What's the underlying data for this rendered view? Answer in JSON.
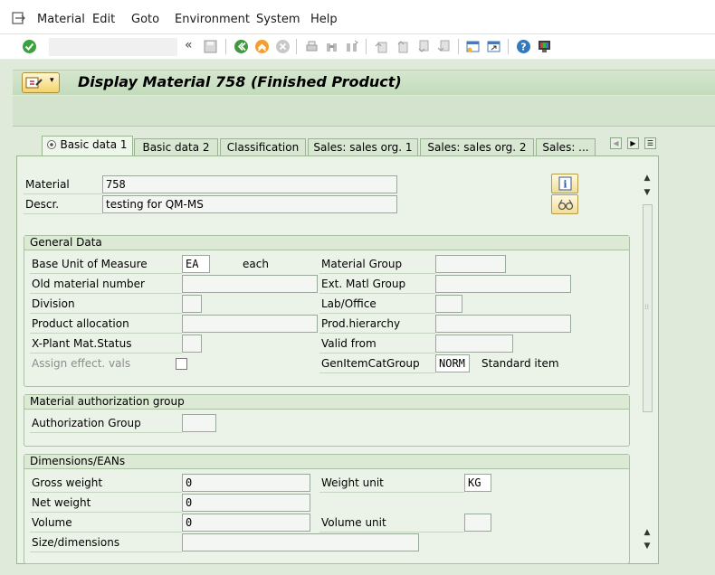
{
  "menu": {
    "items": [
      "Material",
      "Edit",
      "Goto",
      "Environment",
      "System",
      "Help"
    ]
  },
  "toolbar": {
    "command_value": "",
    "icons": [
      "enter-icon",
      "save-icon",
      "back-icon",
      "exit-icon",
      "cancel-icon",
      "print-icon",
      "find-icon",
      "find-next-icon",
      "first-page-icon",
      "previous-page-icon",
      "next-page-icon",
      "last-page-icon",
      "new-session-icon",
      "shortcut-icon",
      "help-icon",
      "customize-layout-icon"
    ]
  },
  "title": "Display Material 758 (Finished Product)",
  "tabs": [
    "Basic data 1",
    "Basic data 2",
    "Classification",
    "Sales: sales org. 1",
    "Sales: sales org. 2",
    "Sales: ..."
  ],
  "header": {
    "material_label": "Material",
    "material_value": "758",
    "descr_label": "Descr.",
    "descr_value": "testing for QM-MS"
  },
  "general_data": {
    "title": "General Data",
    "base_uom_label": "Base Unit of Measure",
    "base_uom_value": "EA",
    "base_uom_text": "each",
    "old_material_label": "Old material number",
    "old_material_value": "",
    "division_label": "Division",
    "division_value": "",
    "product_allocation_label": "Product allocation",
    "product_allocation_value": "",
    "xplant_status_label": "X-Plant Mat.Status",
    "xplant_status_value": "",
    "assign_effect_label": "Assign effect. vals",
    "material_group_label": "Material Group",
    "material_group_value": "",
    "ext_matl_group_label": "Ext. Matl Group",
    "ext_matl_group_value": "",
    "lab_office_label": "Lab/Office",
    "lab_office_value": "",
    "prod_hierarchy_label": "Prod.hierarchy",
    "prod_hierarchy_value": "",
    "valid_from_label": "Valid from",
    "valid_from_value": "",
    "gen_item_cat_label": "GenItemCatGroup",
    "gen_item_cat_value": "NORM",
    "gen_item_cat_text": "Standard item"
  },
  "auth_group": {
    "title": "Material authorization group",
    "auth_group_label": "Authorization Group",
    "auth_group_value": ""
  },
  "dimensions": {
    "title": "Dimensions/EANs",
    "gross_weight_label": "Gross weight",
    "gross_weight_value": "0",
    "net_weight_label": "Net weight",
    "net_weight_value": "0",
    "volume_label": "Volume",
    "volume_value": "0",
    "size_label": "Size/dimensions",
    "size_value": "",
    "weight_unit_label": "Weight unit",
    "weight_unit_value": "KG",
    "volume_unit_label": "Volume unit",
    "volume_unit_value": ""
  },
  "colors": {
    "background": "#dfeadb",
    "panel": "#ebf3e8",
    "title_bar": "#c9dfc2",
    "accent_button": "#f2dd96"
  }
}
